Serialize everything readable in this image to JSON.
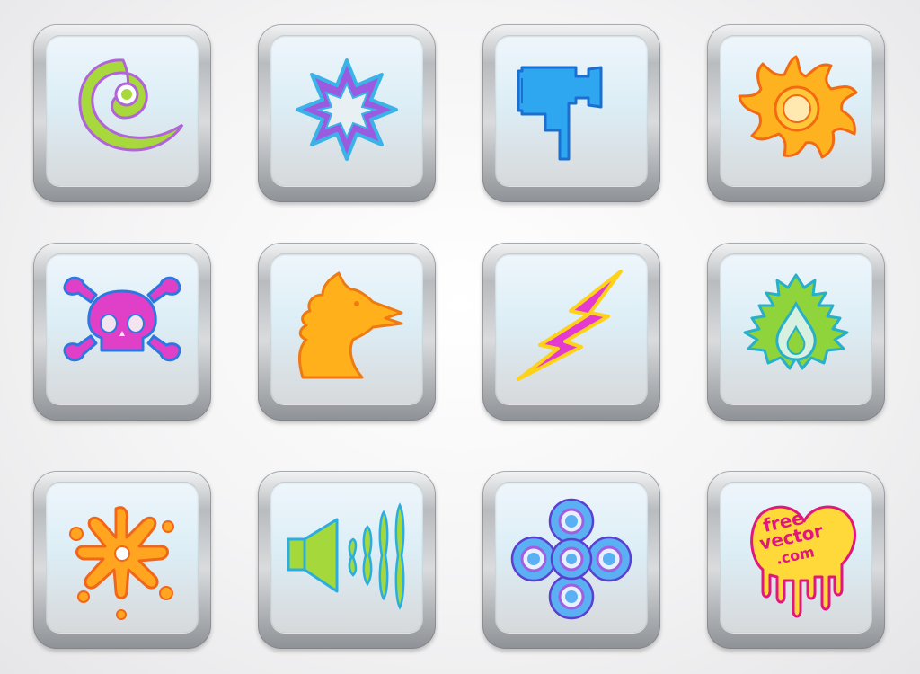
{
  "icons": [
    {
      "name": "spiral-icon",
      "colors": [
        "#a7d93d",
        "#b163d9"
      ]
    },
    {
      "name": "flower-icon",
      "colors": [
        "#9a5be0",
        "#3ab4e8"
      ]
    },
    {
      "name": "video-camera-icon",
      "colors": [
        "#2ea7f0",
        "#1a6fd0"
      ]
    },
    {
      "name": "sun-icon",
      "colors": [
        "#ffb21f",
        "#f26b12"
      ]
    },
    {
      "name": "skull-crossbones-icon",
      "colors": [
        "#e040c8",
        "#2c78e0"
      ]
    },
    {
      "name": "dragon-head-icon",
      "colors": [
        "#ffb01a",
        "#f07a12"
      ]
    },
    {
      "name": "lightning-bolt-icon",
      "colors": [
        "#e43ad0",
        "#ffd21a"
      ]
    },
    {
      "name": "leaf-drop-icon",
      "colors": [
        "#8fd43a",
        "#27b0c8"
      ]
    },
    {
      "name": "splat-star-icon",
      "colors": [
        "#ffa51f",
        "#f2661a"
      ]
    },
    {
      "name": "speaker-sound-icon",
      "colors": [
        "#a5d83a",
        "#2aaee0"
      ]
    },
    {
      "name": "circles-cross-icon",
      "colors": [
        "#5ab0f2",
        "#9f5fe0"
      ]
    },
    {
      "name": "heart-logo-icon",
      "colors": [
        "#ffd93a",
        "#e0187e"
      ]
    }
  ],
  "logo": {
    "line1": "free",
    "line2": "vector",
    "line3": ".com"
  }
}
